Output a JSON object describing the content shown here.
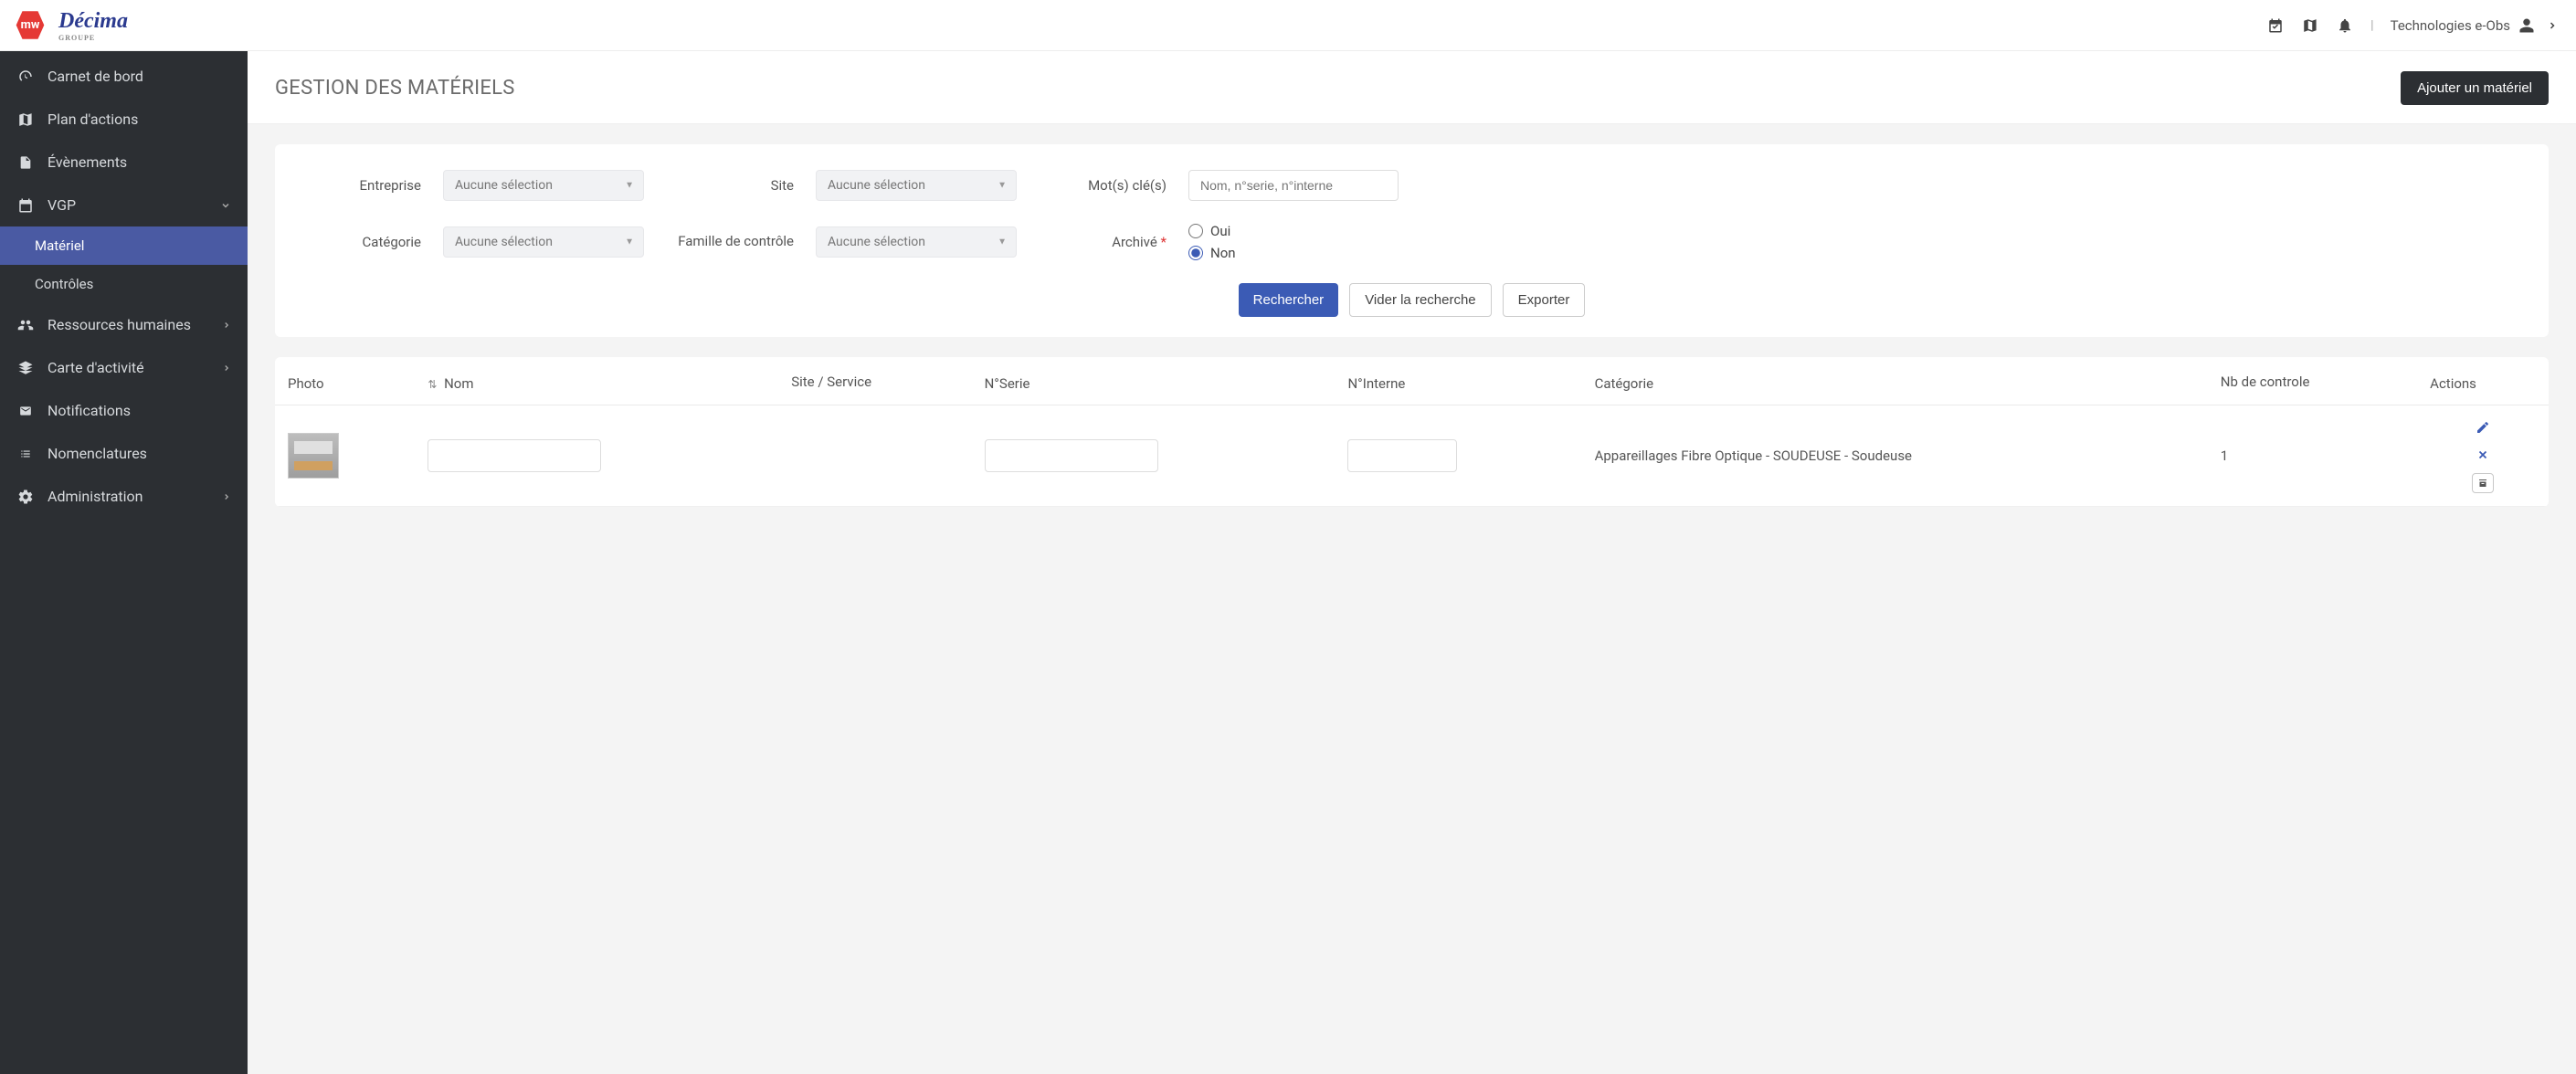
{
  "topbar": {
    "user_name": "Technologies e-Obs"
  },
  "sidebar": {
    "items": [
      {
        "label": "Carnet de bord",
        "icon": "dashboard"
      },
      {
        "label": "Plan d'actions",
        "icon": "map"
      },
      {
        "label": "Évènements",
        "icon": "file"
      },
      {
        "label": "VGP",
        "icon": "calendar",
        "expandable": true,
        "expanded": true,
        "children": [
          {
            "label": "Matériel",
            "active": true
          },
          {
            "label": "Contrôles"
          }
        ]
      },
      {
        "label": "Ressources humaines",
        "icon": "users",
        "expandable": true
      },
      {
        "label": "Carte d'activité",
        "icon": "layers",
        "expandable": true
      },
      {
        "label": "Notifications",
        "icon": "mail"
      },
      {
        "label": "Nomenclatures",
        "icon": "list"
      },
      {
        "label": "Administration",
        "icon": "gear",
        "expandable": true
      }
    ]
  },
  "page": {
    "title": "GESTION DES MATÉRIELS",
    "add_button": "Ajouter un matériel"
  },
  "filters": {
    "entreprise_label": "Entreprise",
    "site_label": "Site",
    "keywords_label": "Mot(s) clé(s)",
    "categorie_label": "Catégorie",
    "famille_label": "Famille de contrôle",
    "archive_label": "Archivé",
    "no_selection": "Aucune sélection",
    "keywords_placeholder": "Nom, n°serie, n°interne",
    "archive_options": {
      "oui": "Oui",
      "non": "Non"
    },
    "archive_selected": "non",
    "search_btn": "Rechercher",
    "clear_btn": "Vider la recherche",
    "export_btn": "Exporter"
  },
  "table": {
    "headers": {
      "photo": "Photo",
      "nom": "Nom",
      "site_service": "Site / Service",
      "nserie": "N°Serie",
      "ninterne": "N°Interne",
      "categorie": "Catégorie",
      "nb_controle": "Nb de controle",
      "actions": "Actions"
    },
    "rows": [
      {
        "nom": "",
        "site_service": "",
        "nserie": "",
        "ninterne": "",
        "categorie": "Appareillages Fibre Optique - SOUDEUSE - Soudeuse",
        "nb_controle": "1"
      }
    ]
  }
}
